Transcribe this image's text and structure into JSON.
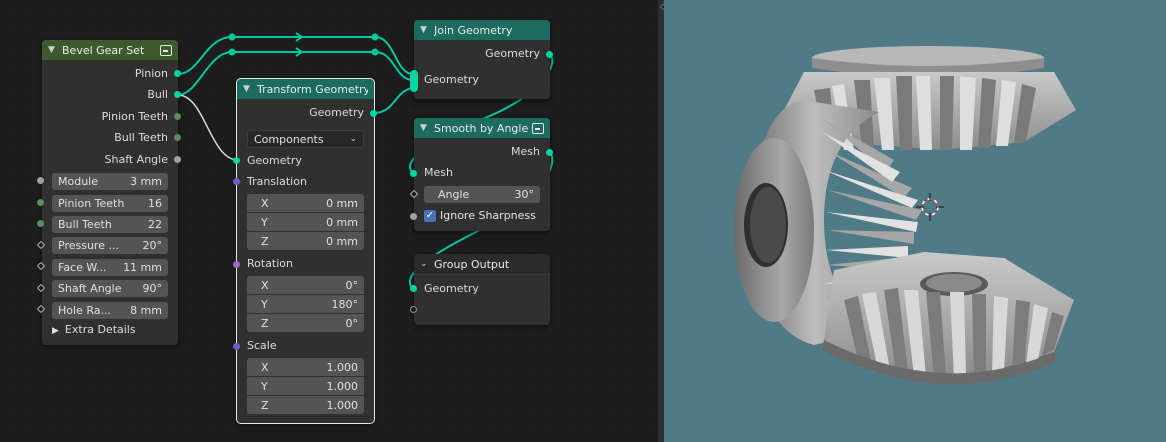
{
  "colors": {
    "editor_bg": "#1d1d1d",
    "node_bg": "#303030",
    "group_header": "#3c5a2e",
    "geometry_header": "#1b6b5f",
    "geometry_socket": "#00d6a3",
    "viewport_bg": "#4f7b86"
  },
  "bevel_gear_set": {
    "title": "Bevel Gear Set",
    "outputs": [
      "Pinion",
      "Bull",
      "Pinion Teeth",
      "Bull Teeth",
      "Shaft Angle"
    ],
    "inputs": [
      {
        "label": "Module",
        "value": "3 mm"
      },
      {
        "label": "Pinion Teeth",
        "value": "16"
      },
      {
        "label": "Bull Teeth",
        "value": "22"
      },
      {
        "label": "Pressure ...",
        "value": "20°"
      },
      {
        "label": "Face W...",
        "value": "11 mm"
      },
      {
        "label": "Shaft Angle",
        "value": "90°"
      },
      {
        "label": "Hole Ra...",
        "value": "8 mm"
      }
    ],
    "extra_details": "Extra Details"
  },
  "transform_geometry": {
    "title": "Transform Geometry",
    "output_label": "Geometry",
    "mode": "Components",
    "geometry_label": "Geometry",
    "translation": {
      "label": "Translation",
      "x": "0 mm",
      "y": "0 mm",
      "z": "0 mm"
    },
    "rotation": {
      "label": "Rotation",
      "x": "0°",
      "y": "180°",
      "z": "0°"
    },
    "scale": {
      "label": "Scale",
      "x": "1.000",
      "y": "1.000",
      "z": "1.000"
    },
    "axis": {
      "x": "X",
      "y": "Y",
      "z": "Z"
    }
  },
  "join_geometry": {
    "title": "Join Geometry",
    "output_label": "Geometry",
    "input_label": "Geometry"
  },
  "smooth_by_angle": {
    "title": "Smooth by Angle",
    "output_label": "Mesh",
    "input_label": "Mesh",
    "angle_label": "Angle",
    "angle_value": "30°",
    "ignore_sharpness": "Ignore Sharpness"
  },
  "group_output": {
    "title": "Group Output",
    "input_label": "Geometry"
  },
  "icons": {
    "collapse": "chevron-down-icon",
    "node_group": "node-group-icon",
    "checkbox": "checkmark-icon",
    "expand": "chevron-right-icon",
    "cursor": "3d-cursor-icon"
  }
}
